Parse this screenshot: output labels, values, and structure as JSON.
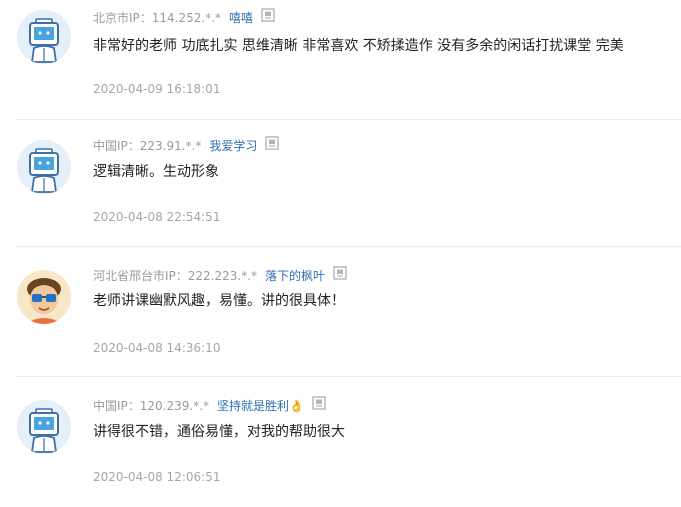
{
  "comments": [
    {
      "location": "北京市IP：114.252.*.*",
      "username": "嘻嘻",
      "avatar": "robot-avatar",
      "content": "非常好的老师 功底扎实 思维清晰 非常喜欢 不矫揉造作 没有多余的闲话打扰课堂 完美",
      "time": "2020-04-09 16:18:01"
    },
    {
      "location": "中国IP：223.91.*.*",
      "username": "我爱学习",
      "avatar": "robot-avatar",
      "content": "逻辑清晰。生动形象",
      "time": "2020-04-08 22:54:51"
    },
    {
      "location": "河北省邢台市IP：222.223.*.*",
      "username": "落下的枫叶",
      "avatar": "cartoon-boy-avatar",
      "content": "老师讲课幽默风趣，易懂。讲的很具体！",
      "time": "2020-04-08 14:36:10"
    },
    {
      "location": "中国IP：120.239.*.*",
      "username": "坚持就是胜利👌",
      "avatar": "robot-avatar",
      "content": "讲得很不错，通俗易懂，对我的帮助很大",
      "time": "2020-04-08 12:06:51"
    }
  ],
  "icons": {
    "report": "report-icon"
  },
  "colors": {
    "username": "#2f6fb3",
    "meta": "#9a9a9a",
    "time": "#a6a6a6",
    "divider": "#ececec"
  }
}
